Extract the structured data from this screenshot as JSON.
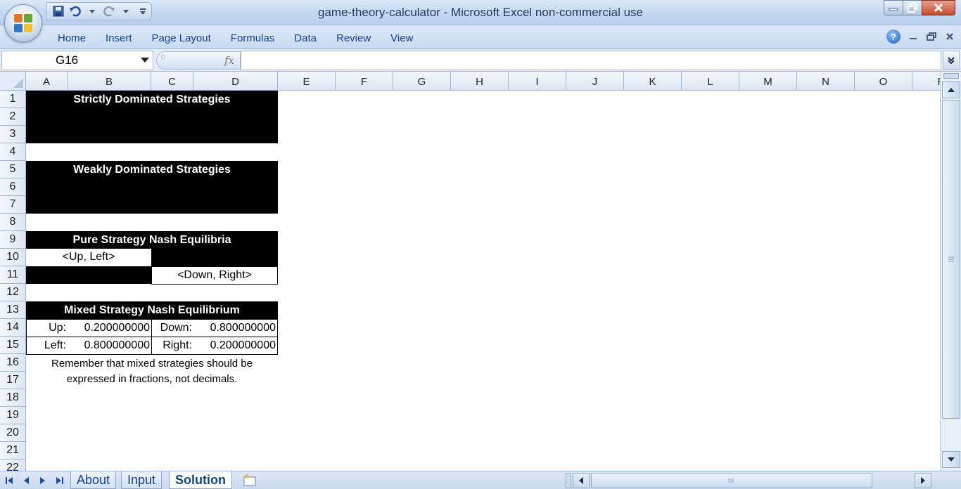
{
  "window": {
    "title": "game-theory-calculator - Microsoft Excel non-commercial use"
  },
  "ribbon": {
    "tabs": [
      "Home",
      "Insert",
      "Page Layout",
      "Formulas",
      "Data",
      "Review",
      "View"
    ],
    "help_label": "?"
  },
  "formula_bar": {
    "name_box": "G16",
    "fx_label": "fx",
    "formula": ""
  },
  "grid": {
    "columns": [
      "A",
      "B",
      "C",
      "D",
      "E",
      "F",
      "G",
      "H",
      "I",
      "J",
      "K",
      "L",
      "M",
      "N",
      "O",
      "P"
    ],
    "rows": [
      "1",
      "2",
      "3",
      "4",
      "5",
      "6",
      "7",
      "8",
      "9",
      "10",
      "11",
      "12",
      "13",
      "14",
      "15",
      "16",
      "17",
      "18",
      "19",
      "20",
      "21",
      "22"
    ]
  },
  "sheet": {
    "strictly_dominated": {
      "header": "Strictly Dominated Strategies"
    },
    "weakly_dominated": {
      "header": "Weakly Dominated Strategies"
    },
    "pure_nash": {
      "header": "Pure Strategy Nash Equilibria",
      "up_left": "<Up, Left>",
      "down_right": "<Down, Right>"
    },
    "mixed_nash": {
      "header": "Mixed Strategy Nash Equilibrium",
      "up_label": "Up:",
      "up_value": "0.200000000",
      "down_label": "Down:",
      "down_value": "0.800000000",
      "left_label": "Left:",
      "left_value": "0.800000000",
      "right_label": "Right:",
      "right_value": "0.200000000"
    },
    "note_line1": "Remember that mixed strategies should be",
    "note_line2": "expressed in fractions, not decimals."
  },
  "sheet_tabs": {
    "about": "About",
    "input": "Input",
    "solution": "Solution",
    "active": "Solution"
  },
  "colors": {
    "header_fill": "#000000",
    "header_text": "#ffffff",
    "ribbon_text": "#15428b"
  }
}
